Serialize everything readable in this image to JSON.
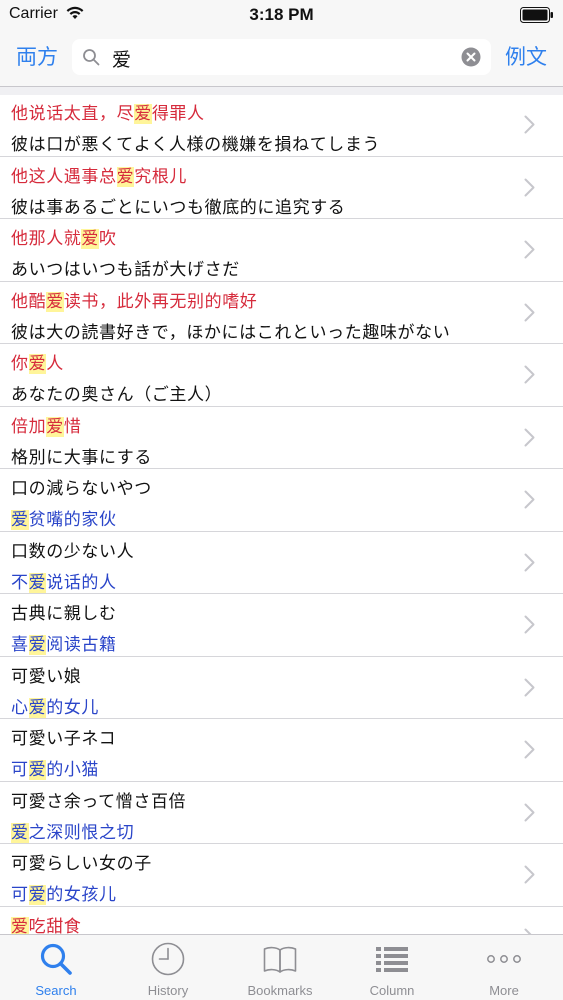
{
  "status_bar": {
    "carrier": "Carrier",
    "time": "3:18 PM"
  },
  "search": {
    "scope_left": "両方",
    "query": "爱",
    "scope_right": "例文"
  },
  "results": [
    {
      "line1": [
        {
          "t": "他说话太直，尽"
        },
        {
          "t": "爱",
          "hl": true
        },
        {
          "t": "得罪人"
        }
      ],
      "line1_lang": "zh",
      "line2": [
        {
          "t": "彼は口が悪くてよく人様の機嫌を損ねてしまう"
        }
      ],
      "line2_lang": "ja"
    },
    {
      "line1": [
        {
          "t": "他这人遇事总"
        },
        {
          "t": "爱",
          "hl": true
        },
        {
          "t": "究根儿"
        }
      ],
      "line1_lang": "zh",
      "line2": [
        {
          "t": "彼は事あるごとにいつも徹底的に追究する"
        }
      ],
      "line2_lang": "ja"
    },
    {
      "line1": [
        {
          "t": "他那人就"
        },
        {
          "t": "爱",
          "hl": true
        },
        {
          "t": "吹"
        }
      ],
      "line1_lang": "zh",
      "line2": [
        {
          "t": "あいつはいつも話が大げさだ"
        }
      ],
      "line2_lang": "ja"
    },
    {
      "line1": [
        {
          "t": "他酷"
        },
        {
          "t": "爱",
          "hl": true
        },
        {
          "t": "读书，此外再无别的嗜好"
        }
      ],
      "line1_lang": "zh",
      "line2": [
        {
          "t": "彼は大の読書好きで，ほかにはこれといった趣味がない"
        }
      ],
      "line2_lang": "ja"
    },
    {
      "line1": [
        {
          "t": "你"
        },
        {
          "t": "爱",
          "hl": true
        },
        {
          "t": "人"
        }
      ],
      "line1_lang": "zh",
      "line2": [
        {
          "t": "あなたの奥さん（ご主人）"
        }
      ],
      "line2_lang": "ja"
    },
    {
      "line1": [
        {
          "t": "倍加"
        },
        {
          "t": "爱",
          "hl": true
        },
        {
          "t": "惜"
        }
      ],
      "line1_lang": "zh",
      "line2": [
        {
          "t": "格別に大事にする"
        }
      ],
      "line2_lang": "ja"
    },
    {
      "line1": [
        {
          "t": "口の減らないやつ"
        }
      ],
      "line1_lang": "ja",
      "line2": [
        {
          "t": "爱",
          "hl": true
        },
        {
          "t": "贫嘴的家伙"
        }
      ],
      "line2_lang": "zh"
    },
    {
      "line1": [
        {
          "t": "口数の少ない人"
        }
      ],
      "line1_lang": "ja",
      "line2": [
        {
          "t": "不"
        },
        {
          "t": "爱",
          "hl": true
        },
        {
          "t": "说话的人"
        }
      ],
      "line2_lang": "zh"
    },
    {
      "line1": [
        {
          "t": "古典に親しむ"
        }
      ],
      "line1_lang": "ja",
      "line2": [
        {
          "t": "喜"
        },
        {
          "t": "爱",
          "hl": true
        },
        {
          "t": "阅读古籍"
        }
      ],
      "line2_lang": "zh"
    },
    {
      "line1": [
        {
          "t": "可愛い娘"
        }
      ],
      "line1_lang": "ja",
      "line2": [
        {
          "t": "心"
        },
        {
          "t": "爱",
          "hl": true
        },
        {
          "t": "的女儿"
        }
      ],
      "line2_lang": "zh"
    },
    {
      "line1": [
        {
          "t": "可愛い子ネコ"
        }
      ],
      "line1_lang": "ja",
      "line2": [
        {
          "t": "可"
        },
        {
          "t": "爱",
          "hl": true
        },
        {
          "t": "的小猫"
        }
      ],
      "line2_lang": "zh"
    },
    {
      "line1": [
        {
          "t": "可愛さ余って憎さ百倍"
        }
      ],
      "line1_lang": "ja",
      "line2": [
        {
          "t": "爱",
          "hl": true
        },
        {
          "t": "之深则恨之切"
        }
      ],
      "line2_lang": "zh"
    },
    {
      "line1": [
        {
          "t": "可愛らしい女の子"
        }
      ],
      "line1_lang": "ja",
      "line2": [
        {
          "t": "可"
        },
        {
          "t": "爱",
          "hl": true
        },
        {
          "t": "的女孩儿"
        }
      ],
      "line2_lang": "zh"
    },
    {
      "line1": [
        {
          "t": "爱",
          "hl": true
        },
        {
          "t": "吃甜食"
        }
      ],
      "line1_lang": "zh",
      "line2": [],
      "line2_lang": "ja"
    }
  ],
  "colors": {
    "accent": "#2f80ed",
    "zh_color": "#d62b3c",
    "zh_color_alt": "#2a45c9",
    "highlight": "#fff59a"
  },
  "tabs": [
    {
      "label": "Search",
      "icon": "search-icon",
      "active": true
    },
    {
      "label": "History",
      "icon": "clock-icon",
      "active": false
    },
    {
      "label": "Bookmarks",
      "icon": "book-icon",
      "active": false
    },
    {
      "label": "Column",
      "icon": "list-icon",
      "active": false
    },
    {
      "label": "More",
      "icon": "more-icon",
      "active": false
    }
  ]
}
